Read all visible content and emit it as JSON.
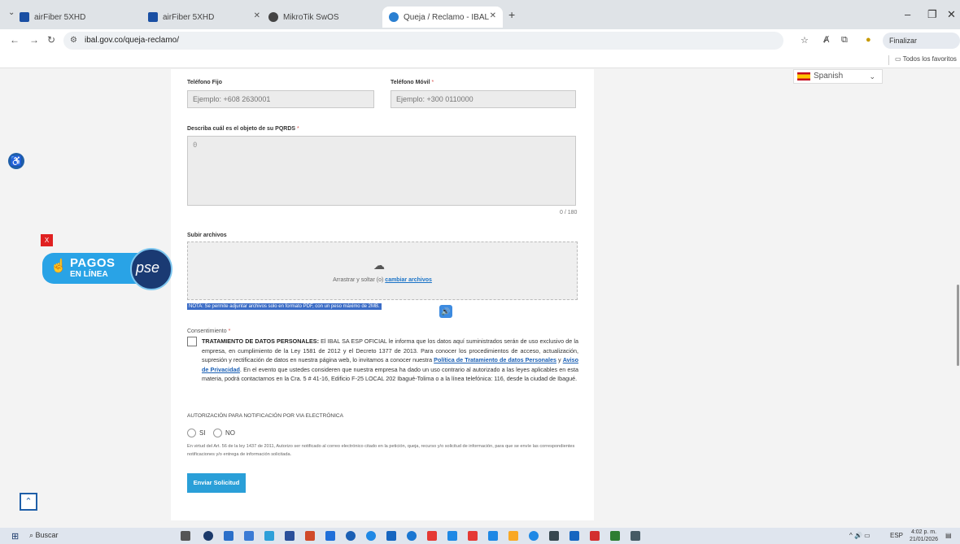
{
  "browser": {
    "tabs": [
      {
        "title": "airFiber 5XHD",
        "color": "#1a4fa3"
      },
      {
        "title": "airFiber 5XHD",
        "color": "#1a4fa3"
      },
      {
        "title": "MikroTik SwOS",
        "color": "#444444"
      },
      {
        "title": "Queja / Reclamo - IBAL SA ESP",
        "color": "#2a7fd1"
      }
    ],
    "url": "ibal.gov.co/queja-reclamo/",
    "update_button": "Finalizar actualización",
    "bookmarks_all": "Todos los favoritos"
  },
  "form": {
    "telefono_fijo": {
      "label": "Teléfono Fijo",
      "placeholder": "Ejemplo: +608 2630001"
    },
    "telefono_movil": {
      "label": "Teléfono Móvil",
      "required": "*",
      "placeholder": "Ejemplo: +300 0110000"
    },
    "objeto": {
      "label": "Describa cuál es el objeto de su PQRDS",
      "required": "*",
      "value": "0",
      "counter": "0 / 180"
    },
    "subir": {
      "label": "Subir archivos",
      "drop_text": "Arrastrar y soltar (o)",
      "change_link": "cambiar archivos"
    },
    "note": "NOTA: Se permite adjuntar archivos solo en formato PDF, con un peso máximo de 2MB.",
    "consentimiento": {
      "label": "Consentimiento",
      "required": "*",
      "bold_title": "TRATAMIENTO DE DATOS PERSONALES:",
      "text_1": " El IBAL SA ESP OFICIAL le informa que los datos aquí suministrados serán de uso exclusivo de la empresa, en cumplimiento de la Ley 1581 de 2012 y el Decreto 1377 de 2013. Para conocer los procedimientos de acceso, actualización, supresión y rectificación de datos en nuestra página web, lo invitamos a conocer nuestra ",
      "link_1": "Política de Tratamiento de datos Personales",
      "text_2": " y ",
      "link_2": "Aviso de Privacidad",
      "text_3": ". En el evento que ustedes consideren que nuestra empresa ha dado un uso contrario al autorizado a las leyes aplicables en esta materia, podrá contactarnos en la Cra. 5 # 41-16, Edificio F-25 LOCAL 202 Ibagué-Tolima o a la línea telefónica: 116, desde la ciudad de Ibagué."
    },
    "autorizacion": {
      "title": "AUTORIZACIÓN PARA NOTIFICACIÓN POR VIA ELECTRÓNICA",
      "si": "SI",
      "no": "NO",
      "text": "En virtud del Art. 56 de la ley 1437 de 2011, Autorizo ser notificado al correo electrónico citado en la petición, queja, recurso y/o solicitud de información, para que se envíe las correspondientes notificaciones y/o entrega de información solicitada."
    },
    "submit": "Enviar Solicitud"
  },
  "widgets": {
    "pagos_1": "PAGOS",
    "pagos_2": "EN LÍNEA",
    "pse": "pse",
    "close": "X",
    "language": "Spanish"
  },
  "taskbar": {
    "search": "Buscar",
    "lang": "ESP",
    "time": "4:02 p. m.",
    "date": "21/01/2026"
  },
  "colors": {
    "accent": "#2a9fd8",
    "link": "#1a5fb4",
    "pse_blue": "#29a3e6"
  }
}
